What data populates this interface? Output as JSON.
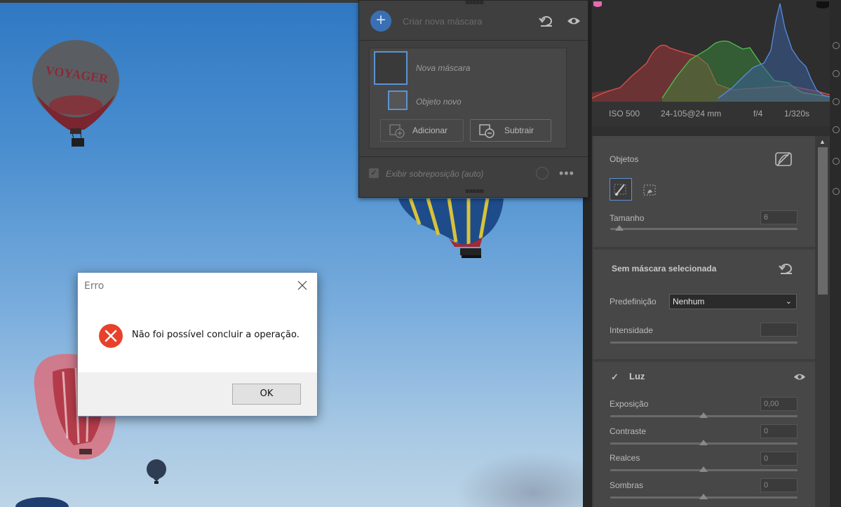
{
  "mask_panel": {
    "create_label": "Criar nova máscara",
    "masks": [
      {
        "name": "Nova máscara"
      },
      {
        "name": "Objeto novo"
      }
    ],
    "add_label": "Adicionar",
    "subtract_label": "Subtrair",
    "overlay_label": "Exibir sobreposição (auto)"
  },
  "photo": {
    "balloon_text": "VOYAGER"
  },
  "right_panel": {
    "exif": {
      "iso": "ISO 500",
      "lens": "24-105@24 mm",
      "aperture": "f/4",
      "shutter": "1/320s"
    },
    "objects": {
      "title": "Objetos",
      "size_label": "Tamanho",
      "size_value": "6"
    },
    "no_mask": {
      "title": "Sem máscara selecionada",
      "preset_label": "Predefinição",
      "preset_value": "Nenhum",
      "intensity_label": "Intensidade",
      "intensity_value": ""
    },
    "light": {
      "title": "Luz",
      "sliders": [
        {
          "label": "Exposição",
          "value": "0,00"
        },
        {
          "label": "Contraste",
          "value": "0"
        },
        {
          "label": "Realces",
          "value": "0"
        },
        {
          "label": "Sombras",
          "value": "0"
        }
      ]
    }
  },
  "dialog": {
    "title": "Erro",
    "message": "Não foi possível concluir a operação.",
    "ok_label": "OK"
  },
  "colors": {
    "accent_blue": "#5a93d4",
    "error_red": "#e8412a",
    "mask_overlay": "#d9707e"
  }
}
